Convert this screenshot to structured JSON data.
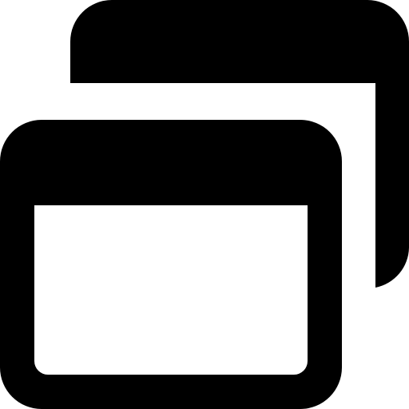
{
  "icon": {
    "name": "window-restore-icon",
    "color": "#000000",
    "background": "#ffffff"
  }
}
